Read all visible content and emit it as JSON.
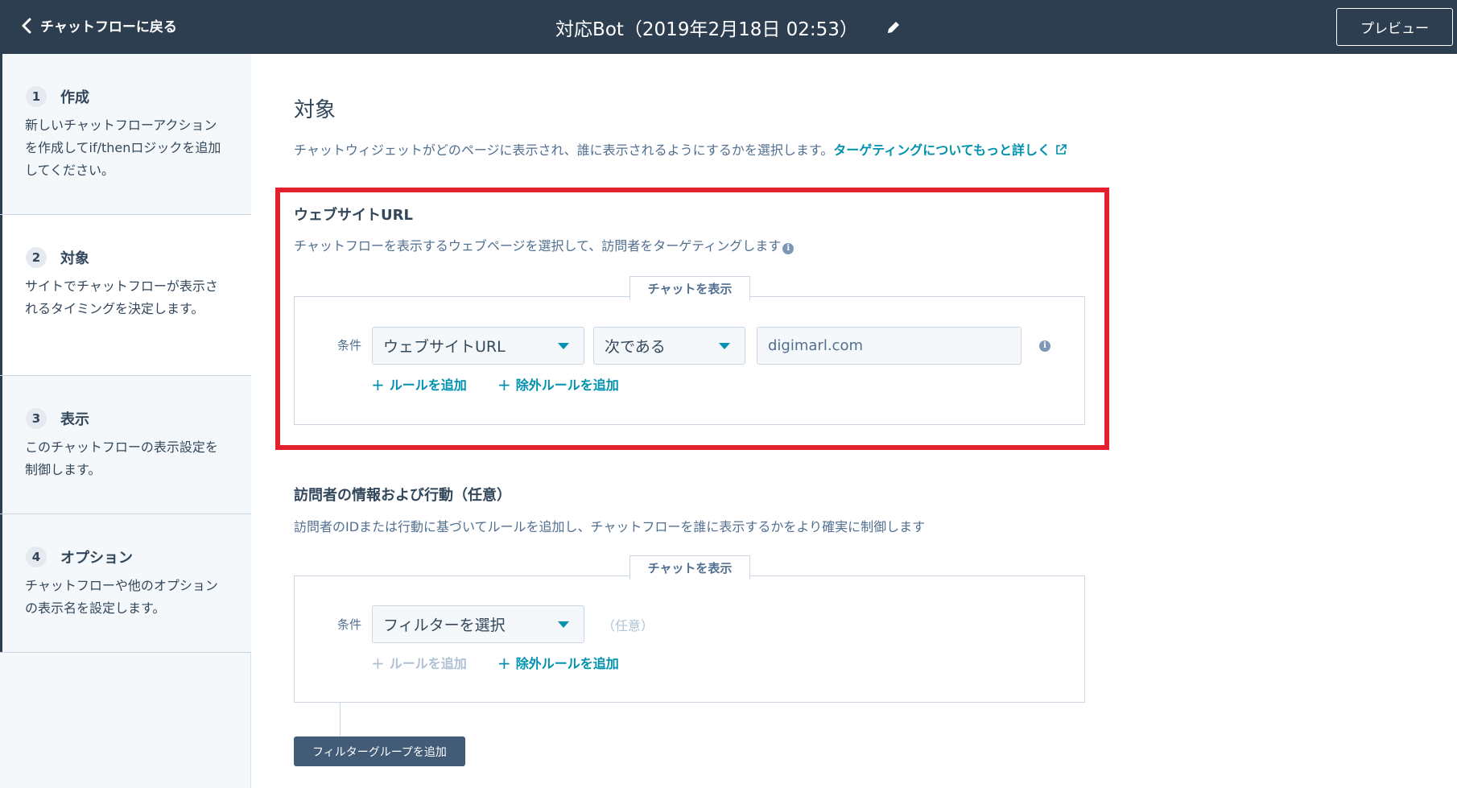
{
  "header": {
    "back_label": "チャットフローに戻る",
    "title": "対応Bot（2019年2月18日 02:53）",
    "preview_label": "プレビュー"
  },
  "sidebar": {
    "steps": [
      {
        "number": "1",
        "title": "作成",
        "description": "新しいチャットフローアクションを作成してif/thenロジックを追加してください。"
      },
      {
        "number": "2",
        "title": "対象",
        "description": "サイトでチャットフローが表示されるタイミングを決定します。"
      },
      {
        "number": "3",
        "title": "表示",
        "description": "このチャットフローの表示設定を制御します。"
      },
      {
        "number": "4",
        "title": "オプション",
        "description": "チャットフローや他のオプションの表示名を設定します。"
      }
    ]
  },
  "main": {
    "title": "対象",
    "description": "チャットウィジェットがどのページに表示され、誰に表示されるようにするかを選択します。",
    "learn_more_link": "ターゲティングについてもっと詳しく"
  },
  "website_url_section": {
    "heading": "ウェブサイトURL",
    "description": "チャットフローを表示するウェブページを選択して、訪問者をターゲティングします",
    "tab_label": "チャットを表示",
    "condition_label": "条件",
    "property_select": "ウェブサイトURL",
    "operator_select": "次である",
    "value": "digimarl.com",
    "add_rule": "ルールを追加",
    "add_exclusion_rule": "除外ルールを追加"
  },
  "visitor_section": {
    "heading": "訪問者の情報および行動（任意）",
    "description": "訪問者のIDまたは行動に基づいてルールを追加し、チャットフローを誰に表示するかをより確実に制御します",
    "tab_label": "チャットを表示",
    "condition_label": "条件",
    "filter_select": "フィルターを選択",
    "optional_text": "（任意）",
    "add_rule": "ルールを追加",
    "add_exclusion_rule": "除外ルールを追加",
    "add_filter_group": "フィルターグループを追加"
  }
}
